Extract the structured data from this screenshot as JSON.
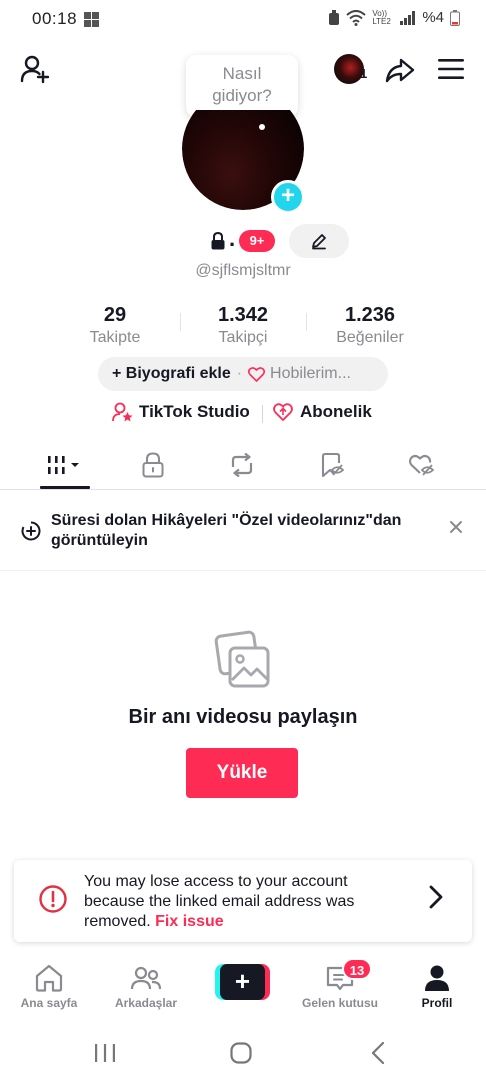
{
  "status_bar": {
    "time": "00:18",
    "network_label": "Vo)) LTE2",
    "battery": "%4"
  },
  "tooltip": {
    "text_line1": "Nasıl",
    "text_line2": "gidiyor?"
  },
  "header": {
    "avatar_count": "1"
  },
  "profile": {
    "name_dot": ".",
    "notification_badge": "9+",
    "username": "@sjflsmjsltmr"
  },
  "stats": [
    {
      "value": "29",
      "label": "Takipte"
    },
    {
      "value": "1.342",
      "label": "Takipçi"
    },
    {
      "value": "1.236",
      "label": "Beğeniler"
    }
  ],
  "bio": {
    "add_label": "+ Biyografi ekle",
    "separator": "·",
    "hobby_label": "Hobilerim..."
  },
  "links": {
    "studio": "TikTok Studio",
    "subscription": "Abonelik"
  },
  "tabs": [
    "videos-grid",
    "private",
    "reposts",
    "favorites",
    "liked"
  ],
  "notice": {
    "text": "Süresi dolan Hikâyeleri \"Özel videolarınız\"dan görüntüleyin"
  },
  "empty_state": {
    "title": "Bir anı videosu paylaşın",
    "upload_label": "Yükle"
  },
  "warning": {
    "text": "You may lose access to your account because the linked email address was removed.",
    "fix_label": "Fix issue"
  },
  "bottom_nav": {
    "home": "Ana sayfa",
    "friends": "Arkadaşlar",
    "create": "+",
    "inbox": "Gelen kutusu",
    "inbox_badge": "13",
    "profile": "Profil"
  },
  "colors": {
    "accent": "#fe2c55",
    "cyan": "#20d5ec",
    "text": "#161823",
    "muted": "#8a8b91"
  }
}
